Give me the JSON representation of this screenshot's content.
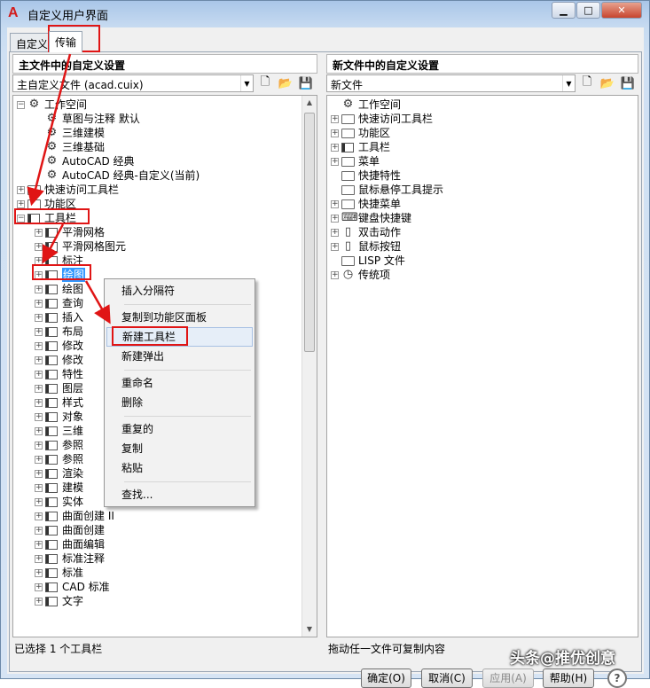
{
  "window": {
    "title": "自定义用户界面",
    "tabs": [
      {
        "label": "自定义"
      },
      {
        "label": "传输",
        "active": true
      }
    ]
  },
  "left": {
    "header": "主文件中的自定义设置",
    "combo_value": "主自定义文件 (acad.cuix)",
    "status": "已选择 1 个工具栏",
    "tree": [
      {
        "label": "工作空间",
        "icon": "gear-icon",
        "level": 0,
        "expander": "-"
      },
      {
        "label": "草图与注释 默认",
        "icon": "gear-icon",
        "level": 1
      },
      {
        "label": "三维建模",
        "icon": "gear-icon",
        "level": 1
      },
      {
        "label": "三维基础",
        "icon": "gear-icon",
        "level": 1
      },
      {
        "label": "AutoCAD 经典",
        "icon": "gear-icon",
        "level": 1
      },
      {
        "label": "AutoCAD 经典-自定义(当前)",
        "icon": "gear-icon",
        "level": 1
      },
      {
        "label": "快速访问工具栏",
        "icon": "quick-access-icon",
        "level": 0,
        "expander": "+"
      },
      {
        "label": "功能区",
        "icon": "folder-icon",
        "level": 0,
        "expander": "+"
      },
      {
        "label": "工具栏",
        "icon": "toolbar-icon",
        "level": 0,
        "expander": "-"
      },
      {
        "label": "平滑网格",
        "icon": "toolbar-icon",
        "level": 1,
        "expander": "+"
      },
      {
        "label": "平滑网格图元",
        "icon": "toolbar-icon",
        "level": 1,
        "expander": "+"
      },
      {
        "label": "标注",
        "icon": "toolbar-icon",
        "level": 1,
        "expander": "+"
      },
      {
        "label": "绘图",
        "icon": "toolbar-icon",
        "level": 1,
        "expander": "+",
        "selected": true
      },
      {
        "label": "绘图",
        "icon": "toolbar-icon",
        "level": 1,
        "expander": "+"
      },
      {
        "label": "查询",
        "icon": "toolbar-icon",
        "level": 1,
        "expander": "+"
      },
      {
        "label": "插入",
        "icon": "toolbar-icon",
        "level": 1,
        "expander": "+"
      },
      {
        "label": "布局",
        "icon": "toolbar-icon",
        "level": 1,
        "expander": "+"
      },
      {
        "label": "修改",
        "icon": "toolbar-icon",
        "level": 1,
        "expander": "+"
      },
      {
        "label": "修改",
        "icon": "toolbar-icon",
        "level": 1,
        "expander": "+"
      },
      {
        "label": "特性",
        "icon": "toolbar-icon",
        "level": 1,
        "expander": "+"
      },
      {
        "label": "图层",
        "icon": "toolbar-icon",
        "level": 1,
        "expander": "+"
      },
      {
        "label": "样式",
        "icon": "toolbar-icon",
        "level": 1,
        "expander": "+"
      },
      {
        "label": "对象",
        "icon": "toolbar-icon",
        "level": 1,
        "expander": "+"
      },
      {
        "label": "三维",
        "icon": "toolbar-icon",
        "level": 1,
        "expander": "+"
      },
      {
        "label": "参照",
        "icon": "toolbar-icon",
        "level": 1,
        "expander": "+"
      },
      {
        "label": "参照",
        "icon": "toolbar-icon",
        "level": 1,
        "expander": "+"
      },
      {
        "label": "渲染",
        "icon": "toolbar-icon",
        "level": 1,
        "expander": "+"
      },
      {
        "label": "建模",
        "icon": "toolbar-icon",
        "level": 1,
        "expander": "+"
      },
      {
        "label": "实体",
        "icon": "toolbar-icon",
        "level": 1,
        "expander": "+"
      },
      {
        "label": "曲面创建 II",
        "icon": "toolbar-icon",
        "level": 1,
        "expander": "+"
      },
      {
        "label": "曲面创建",
        "icon": "toolbar-icon",
        "level": 1,
        "expander": "+"
      },
      {
        "label": "曲面编辑",
        "icon": "toolbar-icon",
        "level": 1,
        "expander": "+"
      },
      {
        "label": "标准注释",
        "icon": "toolbar-icon",
        "level": 1,
        "expander": "+"
      },
      {
        "label": "标准",
        "icon": "toolbar-icon",
        "level": 1,
        "expander": "+"
      },
      {
        "label": "CAD 标准",
        "icon": "toolbar-icon",
        "level": 1,
        "expander": "+"
      },
      {
        "label": "文字",
        "icon": "toolbar-icon",
        "level": 1,
        "expander": "+"
      }
    ]
  },
  "right": {
    "header": "新文件中的自定义设置",
    "combo_value": "新文件",
    "status": "拖动任一文件可复制内容",
    "tree": [
      {
        "label": "工作空间",
        "icon": "gear-icon",
        "level": 0
      },
      {
        "label": "快速访问工具栏",
        "icon": "quick-access-icon",
        "level": 0,
        "expander": "+"
      },
      {
        "label": "功能区",
        "icon": "folder-icon",
        "level": 0,
        "expander": "+"
      },
      {
        "label": "工具栏",
        "icon": "toolbar-icon",
        "level": 0,
        "expander": "+"
      },
      {
        "label": "菜单",
        "icon": "menu-icon",
        "level": 0,
        "expander": "+"
      },
      {
        "label": "快捷特性",
        "icon": "properties-icon",
        "level": 0
      },
      {
        "label": "鼠标悬停工具提示",
        "icon": "tooltip-icon",
        "level": 0
      },
      {
        "label": "快捷菜单",
        "icon": "context-menu-icon",
        "level": 0,
        "expander": "+"
      },
      {
        "label": "键盘快捷键",
        "icon": "keyboard-icon",
        "level": 0,
        "expander": "+"
      },
      {
        "label": "双击动作",
        "icon": "mouse-icon",
        "level": 0,
        "expander": "+"
      },
      {
        "label": "鼠标按钮",
        "icon": "mouse-icon",
        "level": 0,
        "expander": "+"
      },
      {
        "label": "LISP 文件",
        "icon": "lisp-file-icon",
        "level": 0
      },
      {
        "label": "传统项",
        "icon": "clock-icon",
        "level": 0,
        "expander": "+"
      }
    ]
  },
  "context_menu": {
    "groups": [
      [
        "插入分隔符"
      ],
      [
        "复制到功能区面板",
        "新建工具栏",
        "新建弹出"
      ],
      [
        "重命名",
        "删除"
      ],
      [
        "重复的",
        "复制",
        "粘贴"
      ],
      [
        "查找..."
      ]
    ],
    "highlighted": "新建工具栏"
  },
  "buttons": {
    "ok": "确定(O)",
    "cancel": "取消(C)",
    "apply": "应用(A)",
    "help": "帮助(H)"
  },
  "watermark": "头条@推优创意",
  "colors": {
    "annotation_red": "#e01515",
    "selection_blue": "#3399ff"
  }
}
